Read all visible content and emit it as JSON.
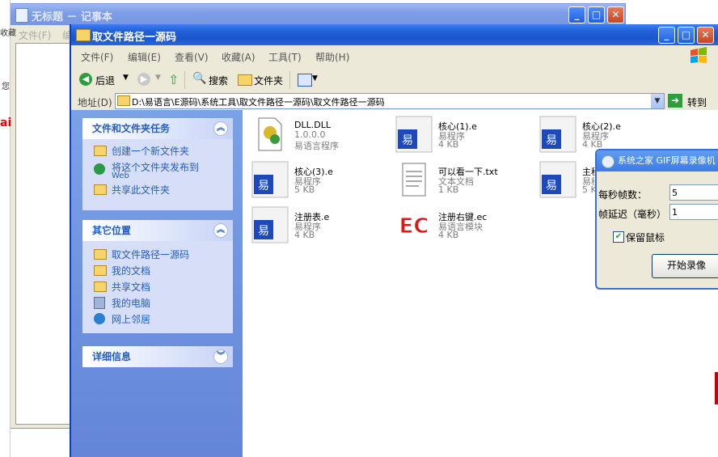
{
  "notepad": {
    "title": "无标题 － 记事本",
    "menu": [
      "文件(F)",
      "编"
    ],
    "fragments": [
      "收藏",
      "您",
      "ai"
    ]
  },
  "explorer": {
    "title": "取文件路径一源码",
    "menu": [
      "文件(F)",
      "编辑(E)",
      "查看(V)",
      "收藏(A)",
      "工具(T)",
      "帮助(H)"
    ],
    "toolbar": {
      "back": "后退",
      "search": "搜索",
      "folders": "文件夹"
    },
    "address": {
      "label": "地址(D)",
      "path": "D:\\易语言\\E源码\\系统工具\\取文件路径一源码\\取文件路径一源码",
      "go": "转到"
    },
    "tasks": {
      "title": "文件和文件夹任务",
      "items": [
        "创建一个新文件夹",
        "将这个文件夹发布到",
        "Web",
        "共享此文件夹"
      ]
    },
    "places": {
      "title": "其它位置",
      "items": [
        "取文件路径一源码",
        "我的文档",
        "共享文档",
        "我的电脑",
        "网上邻居"
      ]
    },
    "details": {
      "title": "详细信息"
    },
    "files": [
      {
        "name": "DLL.DLL",
        "type": "1.0.0.0",
        "size": "易语言程序",
        "icon": "dll-icon"
      },
      {
        "name": "核心(1).e",
        "type": "易程序",
        "size": "4 KB",
        "icon": "e-program-icon"
      },
      {
        "name": "核心(2).e",
        "type": "易程序",
        "size": "4 KB",
        "icon": "e-program-icon"
      },
      {
        "name": "核心(3).e",
        "type": "易程序",
        "size": "5 KB",
        "icon": "e-program-icon"
      },
      {
        "name": "可以看一下.txt",
        "type": "文本文档",
        "size": "1 KB",
        "icon": "text-file-icon"
      },
      {
        "name": "主程",
        "type": "易程",
        "size": "5 K",
        "icon": "e-program-icon"
      },
      {
        "name": "注册表.e",
        "type": "易程序",
        "size": "4 KB",
        "icon": "e-program-icon"
      },
      {
        "name": "注册右键.ec",
        "type": "易语言模块",
        "size": "4 KB",
        "icon": "ec-module-icon"
      }
    ]
  },
  "gif_recorder": {
    "title": "系统之家 GIF屏幕录像机",
    "fps_label": "每秒帧数：",
    "fps_value": "5",
    "delay_label": "帧延迟（毫秒）",
    "delay_value": "1",
    "keep_mouse": "保留鼠标",
    "start": "开始录像"
  }
}
